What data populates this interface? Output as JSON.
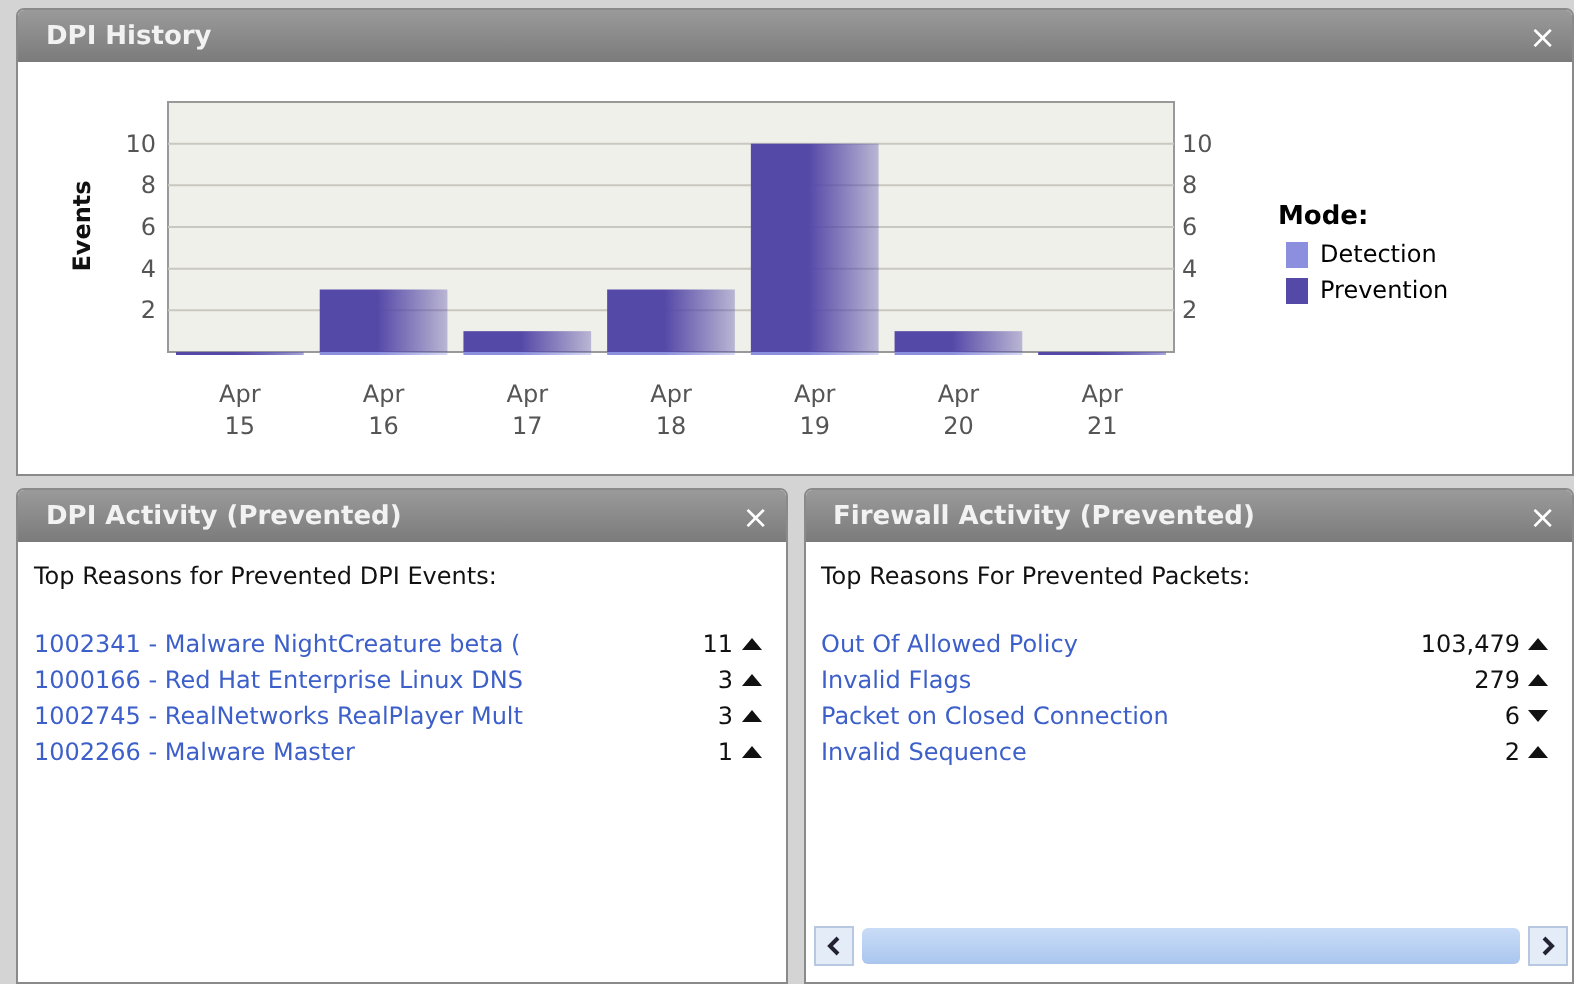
{
  "history_panel": {
    "title": "DPI History",
    "close": "×",
    "chart_data": {
      "type": "bar",
      "ylabel": "Events",
      "categories": [
        "Apr\n15",
        "Apr\n16",
        "Apr\n17",
        "Apr\n18",
        "Apr\n19",
        "Apr\n20",
        "Apr\n21"
      ],
      "ylim": [
        0,
        12
      ],
      "yticks": [
        2,
        4,
        6,
        8,
        10
      ],
      "grid": true,
      "stacked": true,
      "series": [
        {
          "name": "Detection",
          "color": "#8c8fde",
          "values": [
            0,
            0,
            0,
            0,
            0,
            0,
            0
          ]
        },
        {
          "name": "Prevention",
          "color": "#5549a8",
          "values": [
            0,
            3,
            1,
            3,
            10,
            1,
            0
          ]
        }
      ]
    },
    "left_axis_labels": [
      "10",
      "8",
      "6",
      "4",
      "2"
    ],
    "right_axis_labels": [
      "10",
      "8",
      "6",
      "4",
      "2"
    ],
    "legend_title": "Mode:"
  },
  "dpi_panel": {
    "title": "DPI Activity (Prevented)",
    "close": "×",
    "heading": "Top Reasons for Prevented DPI Events:",
    "rows": [
      {
        "label": "1002341 - Malware NightCreature beta (",
        "count": "11",
        "rising": true
      },
      {
        "label": "1000166 - Red Hat Enterprise Linux DNS",
        "count": "3",
        "rising": true
      },
      {
        "label": "1002745 - RealNetworks RealPlayer Mult",
        "count": "3",
        "rising": true
      },
      {
        "label": "1002266 - Malware Master",
        "count": "1",
        "rising": true
      }
    ]
  },
  "firewall_panel": {
    "title": "Firewall Activity (Prevented)",
    "close": "×",
    "heading": "Top Reasons For Prevented Packets:",
    "rows": [
      {
        "label": "Out Of Allowed Policy",
        "count": "103,479",
        "rising": true
      },
      {
        "label": "Invalid Flags",
        "count": "279",
        "rising": true
      },
      {
        "label": "Packet on Closed Connection",
        "count": "6",
        "rising": false
      },
      {
        "label": "Invalid Sequence",
        "count": "2",
        "rising": true
      }
    ]
  }
}
